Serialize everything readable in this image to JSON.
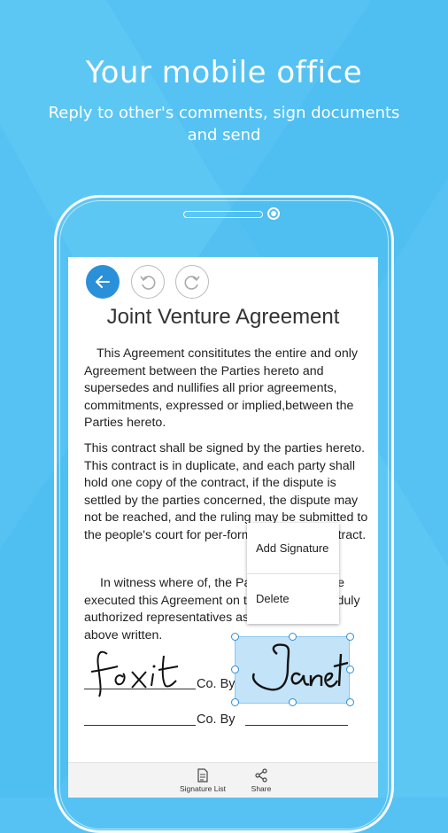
{
  "hero": {
    "title": "Your mobile office",
    "subtitle": "Reply to other's comments, sign documents and send"
  },
  "toolbar": {
    "back_icon": "arrow-left-icon",
    "undo_icon": "undo-icon",
    "redo_icon": "redo-icon"
  },
  "document": {
    "title": "Joint Venture Agreement",
    "para1": "This Agreement consititutes the entire and only Agreement between the Parties hereto and supersedes and nullifies all prior agreements, commitments, expressed or implied,between the Parties hereto.",
    "para2": "This contract shall be signed by the parties hereto. This contract is in duplicate, and each party shall hold one copy of the contract, if the dispute is settled by the parties concerned, the dispute may not be reached, and the ruling may be submitted to the people's court for per-formance of the contract.",
    "para3": "In witness where of, the Parties hereto have executed this Agreement on the date by their duly authorized representatives as of the date first above written.",
    "signature_left": "foxit",
    "signature_right": "Janet",
    "co_by_1": "Co. By",
    "co_by_2": "Co. By"
  },
  "context_menu": {
    "add_signature": "Add Signature",
    "delete": "Delete"
  },
  "bottom_bar": {
    "signature_list": "Signature List",
    "share": "Share"
  },
  "colors": {
    "background": "#55c2f3",
    "accent": "#2a90d9",
    "selection": "#c3e3f8"
  }
}
